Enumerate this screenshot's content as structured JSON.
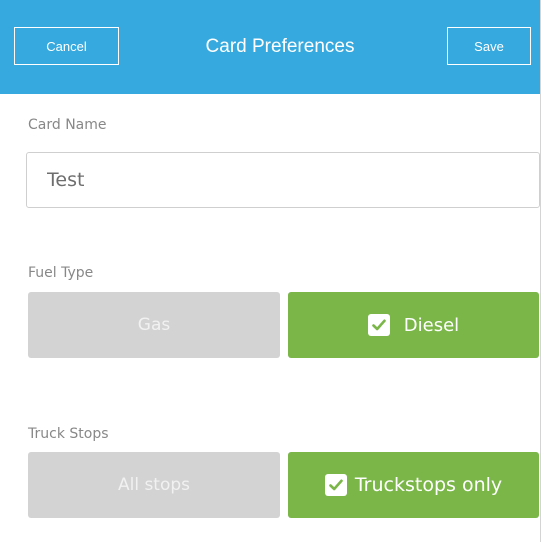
{
  "header": {
    "cancel_label": "Cancel",
    "title": "Card Preferences",
    "save_label": "Save",
    "background_color": "#36a9de"
  },
  "card_name": {
    "label": "Card Name",
    "value": "Test"
  },
  "fuel_type": {
    "label": "Fuel Type",
    "options": [
      {
        "label": "Gas",
        "selected": false
      },
      {
        "label": "Diesel",
        "selected": true
      }
    ]
  },
  "truck_stops": {
    "label": "Truck Stops",
    "options": [
      {
        "label": "All stops",
        "selected": false
      },
      {
        "label": "Truckstops only",
        "selected": true
      }
    ]
  },
  "colors": {
    "selected": "#7ab648",
    "unselected": "#d3d3d3"
  },
  "icons": {
    "checkbox": "check-icon"
  }
}
